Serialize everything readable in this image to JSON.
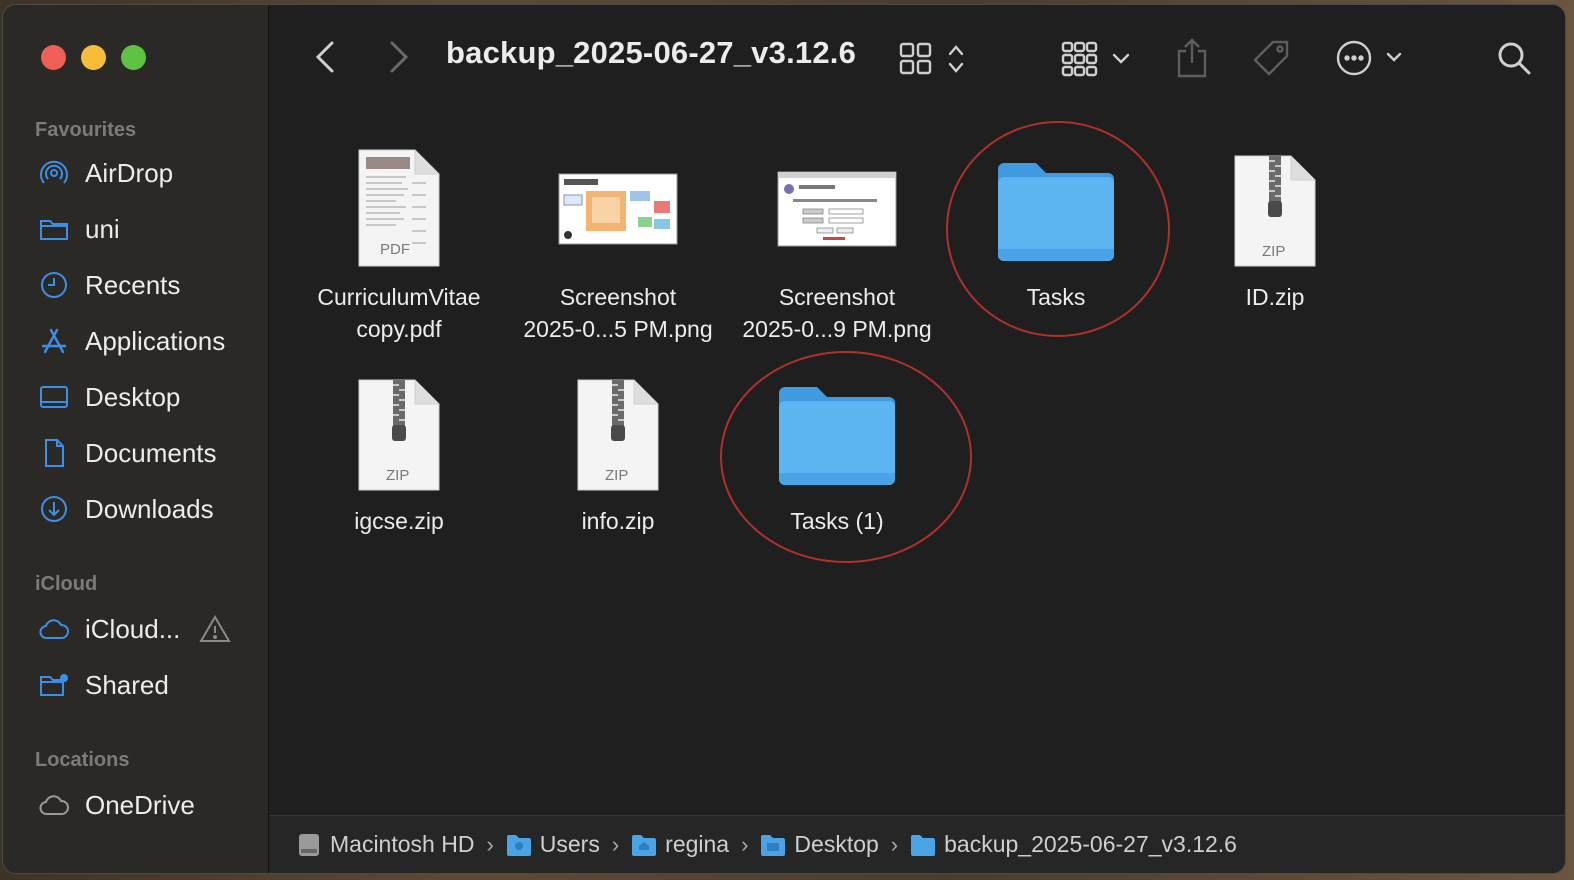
{
  "window": {
    "title": "backup_2025-06-27_v3.12.6"
  },
  "sidebar": {
    "favourites_title": "Favourites",
    "favourites": [
      {
        "label": "AirDrop",
        "icon": "airdrop-icon"
      },
      {
        "label": "uni",
        "icon": "folder-icon"
      },
      {
        "label": "Recents",
        "icon": "clock-icon"
      },
      {
        "label": "Applications",
        "icon": "applications-icon"
      },
      {
        "label": "Desktop",
        "icon": "desktop-icon"
      },
      {
        "label": "Documents",
        "icon": "document-icon"
      },
      {
        "label": "Downloads",
        "icon": "download-icon"
      }
    ],
    "icloud_title": "iCloud",
    "icloud": [
      {
        "label": "iCloud...",
        "icon": "cloud-icon"
      },
      {
        "label": "Shared",
        "icon": "shared-folder-icon"
      }
    ],
    "locations_title": "Locations",
    "locations": [
      {
        "label": "OneDrive",
        "icon": "cloud-icon"
      }
    ]
  },
  "files": [
    {
      "label": "CurriculumVitae\ncopy.pdf",
      "kind": "pdf",
      "type_text": "PDF"
    },
    {
      "label": "Screenshot\n2025-0...5 PM.png",
      "kind": "image"
    },
    {
      "label": "Screenshot\n2025-0...9 PM.png",
      "kind": "image"
    },
    {
      "label": "Tasks",
      "kind": "folder",
      "circled": true
    },
    {
      "label": "ID.zip",
      "kind": "zip",
      "type_text": "ZIP"
    },
    {
      "label": "igcse.zip",
      "kind": "zip",
      "type_text": "ZIP"
    },
    {
      "label": "info.zip",
      "kind": "zip",
      "type_text": "ZIP"
    },
    {
      "label": "Tasks (1)",
      "kind": "folder",
      "circled": true
    }
  ],
  "pathbar": [
    {
      "label": "Macintosh HD",
      "icon": "hard-drive-icon"
    },
    {
      "label": "Users",
      "icon": "folder-icon"
    },
    {
      "label": "regina",
      "icon": "home-folder-icon"
    },
    {
      "label": "Desktop",
      "icon": "desktop-folder-icon"
    },
    {
      "label": "backup_2025-06-27_v3.12.6",
      "icon": "folder-icon"
    }
  ],
  "colors": {
    "accent": "#3d8fe6",
    "folder": "#5cb4f0",
    "annotation": "#b0302a"
  }
}
